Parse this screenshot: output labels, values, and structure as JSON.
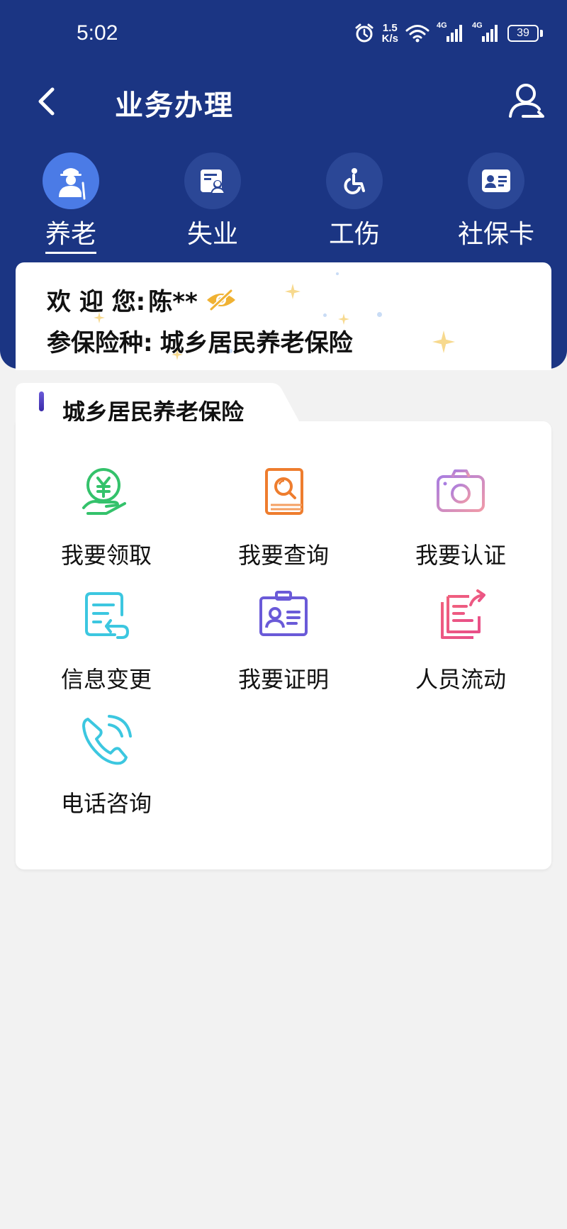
{
  "status_bar": {
    "time": "5:02",
    "net_speed_value": "1.5",
    "net_speed_unit": "K/s",
    "signal_1": "4G",
    "signal_2": "4G",
    "battery": "39"
  },
  "nav": {
    "title": "业务办理",
    "back_icon": "chevron-left-icon",
    "user_icon": "user-switch-icon"
  },
  "categories": [
    {
      "label": "养老",
      "icon": "elderly-person-icon",
      "active": true
    },
    {
      "label": "失业",
      "icon": "id-document-icon",
      "active": false
    },
    {
      "label": "工伤",
      "icon": "wheelchair-icon",
      "active": false
    },
    {
      "label": "社保卡",
      "icon": "id-card-icon",
      "active": false
    }
  ],
  "welcome": {
    "greeting_label": "欢 迎 您:",
    "user_name": "陈**",
    "insurance_label": "参保险种:",
    "insurance_type": "城乡居民养老保险"
  },
  "panel": {
    "title": "城乡居民养老保险",
    "services": [
      {
        "label": "我要领取",
        "icon": "yuan-hand-icon",
        "color": "#34c26b"
      },
      {
        "label": "我要查询",
        "icon": "book-search-icon",
        "color": "#ee7d2e"
      },
      {
        "label": "我要认证",
        "icon": "camera-icon",
        "color": "#b57ad8"
      },
      {
        "label": "信息变更",
        "icon": "document-edit-icon",
        "color": "#3cc7e0"
      },
      {
        "label": "我要证明",
        "icon": "id-badge-icon",
        "color": "#6a5ad8"
      },
      {
        "label": "人员流动",
        "icon": "document-transfer-icon",
        "color": "#f0607e"
      },
      {
        "label": "电话咨询",
        "icon": "phone-call-icon",
        "color": "#3cc7e0"
      }
    ]
  },
  "colors": {
    "header_bg": "#1b3583",
    "active_tab": "#4b7be6",
    "page_bg": "#f2f2f2"
  }
}
